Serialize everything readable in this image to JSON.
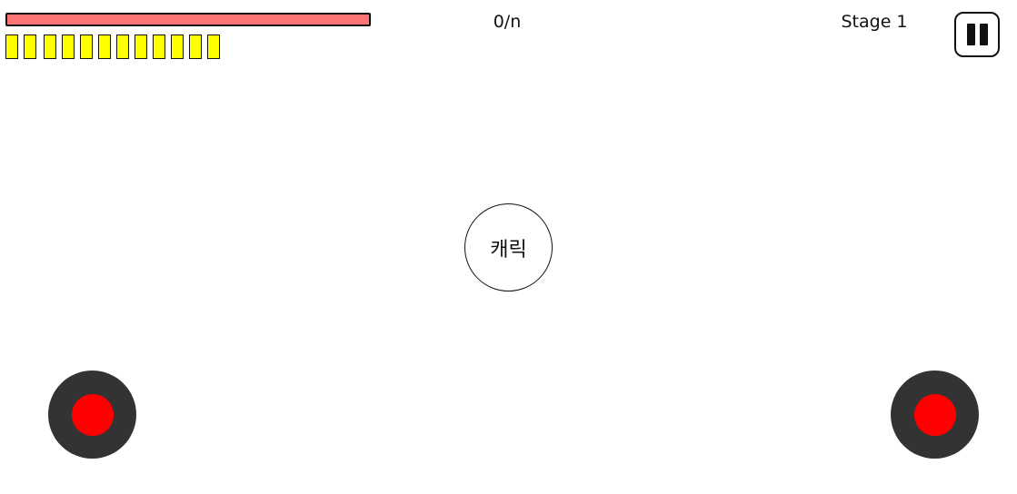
{
  "hud": {
    "health": {
      "fraction": 1.0,
      "color": "#ff7575"
    },
    "ammo": {
      "count": 12,
      "color": "#ffff00"
    },
    "score_text": "0/n",
    "stage_text": "Stage 1",
    "pause_icon": "pause-icon"
  },
  "character": {
    "label": "캐릭"
  },
  "controls": {
    "left_joystick": {
      "base_color": "#333333",
      "knob_color": "#ff0000"
    },
    "right_joystick": {
      "base_color": "#333333",
      "knob_color": "#ff0000"
    }
  }
}
